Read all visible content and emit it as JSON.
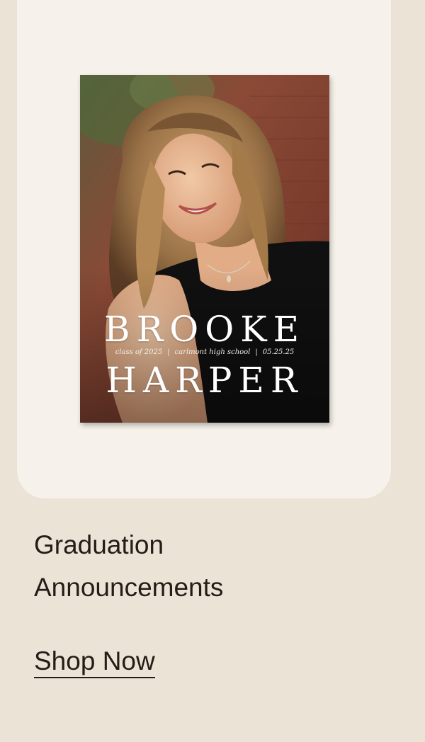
{
  "card": {
    "invitation": {
      "first_name": "BROOKE",
      "last_name": "HARPER",
      "details": [
        "class of 2025",
        "carlmont high school",
        "05.25.25"
      ],
      "separator": "|"
    }
  },
  "title": {
    "line1": "Graduation",
    "line2": "Announcements"
  },
  "cta": {
    "label": "Shop Now"
  },
  "colors": {
    "page_background": "#ebe4d6",
    "card_background": "#f6f2eb",
    "text": "#231d17"
  }
}
